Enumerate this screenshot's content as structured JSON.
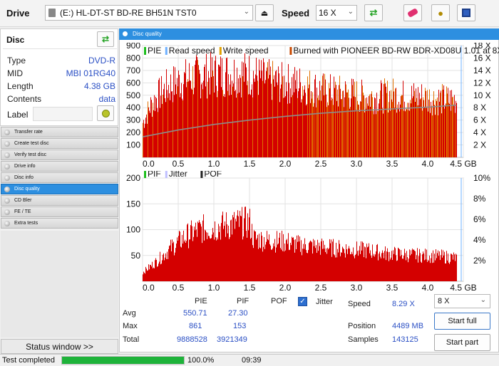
{
  "toolbar": {
    "drive_label": "Drive",
    "drive_value": "(E:)   HL-DT-ST BD-RE  BH51N TST0",
    "speed_label": "Speed",
    "speed_value": "16 X"
  },
  "disc": {
    "title": "Disc",
    "rows": [
      {
        "key": "Type",
        "value": "DVD-R"
      },
      {
        "key": "MID",
        "value": "MBI 01RG40"
      },
      {
        "key": "Length",
        "value": "4.38 GB"
      },
      {
        "key": "Contents",
        "value": "data"
      }
    ],
    "label_key": "Label",
    "label_value": ""
  },
  "nav": {
    "items": [
      "Transfer rate",
      "Create test disc",
      "Verify test disc",
      "Drive info",
      "Disc info",
      "Disc quality",
      "CD Bler",
      "FE / TE",
      "Extra tests"
    ],
    "active_index": 5
  },
  "main": {
    "title": "Disc quality"
  },
  "chart_data": [
    {
      "type": "area",
      "legend": [
        "PIE",
        "Read speed",
        "Write speed",
        "Burned with PIONEER BD-RW  BDR-XD08U 1.01 at 8X"
      ],
      "legend_colors": [
        "#1fbf1f",
        "#6fb0ff",
        "#e0a000",
        "#c84800"
      ],
      "y_ticks": [
        100,
        200,
        300,
        400,
        500,
        600,
        700,
        800,
        900
      ],
      "y_right_ticks": [
        "2 X",
        "4 X",
        "6 X",
        "8 X",
        "10 X",
        "12 X",
        "14 X",
        "16 X",
        "18 X"
      ],
      "x_ticks": [
        "0.0",
        "0.5",
        "1.0",
        "1.5",
        "2.0",
        "2.5",
        "3.0",
        "3.5",
        "4.0",
        "4.5 GB"
      ],
      "xlim": [
        0,
        4.5
      ],
      "ylim": [
        0,
        900
      ],
      "y2lim": [
        0,
        18
      ],
      "pie_profile": [
        [
          0.0,
          320
        ],
        [
          0.1,
          470
        ],
        [
          0.2,
          560
        ],
        [
          0.35,
          650
        ],
        [
          0.5,
          700
        ],
        [
          0.7,
          740
        ],
        [
          0.9,
          760
        ],
        [
          1.1,
          770
        ],
        [
          1.3,
          775
        ],
        [
          1.5,
          770
        ],
        [
          1.7,
          720
        ],
        [
          1.9,
          690
        ],
        [
          2.1,
          680
        ],
        [
          2.3,
          660
        ],
        [
          2.5,
          620
        ],
        [
          2.7,
          600
        ],
        [
          2.9,
          590
        ],
        [
          3.1,
          560
        ],
        [
          3.3,
          560
        ],
        [
          3.5,
          580
        ],
        [
          3.7,
          560
        ],
        [
          3.9,
          560
        ],
        [
          4.1,
          540
        ],
        [
          4.3,
          530
        ],
        [
          4.4,
          540
        ]
      ],
      "read_speed": [
        [
          0.0,
          3.3
        ],
        [
          0.5,
          4.4
        ],
        [
          1.0,
          5.3
        ],
        [
          1.5,
          6.0
        ],
        [
          2.0,
          6.6
        ],
        [
          2.5,
          7.1
        ],
        [
          3.0,
          7.5
        ],
        [
          3.5,
          7.8
        ],
        [
          4.0,
          8.1
        ],
        [
          4.4,
          8.4
        ]
      ]
    },
    {
      "type": "area",
      "legend": [
        "PIF",
        "Jitter",
        "POF"
      ],
      "legend_colors": [
        "#1fbf1f",
        "#c0c0ff",
        "#222222"
      ],
      "y_ticks": [
        50,
        100,
        150,
        200
      ],
      "y_right_ticks": [
        "2%",
        "4%",
        "6%",
        "8%",
        "10%"
      ],
      "x_ticks": [
        "0.0",
        "0.5",
        "1.0",
        "1.5",
        "2.0",
        "2.5",
        "3.0",
        "3.5",
        "4.0",
        "4.5 GB"
      ],
      "xlim": [
        0,
        4.5
      ],
      "ylim": [
        0,
        200
      ],
      "pif_profile": [
        [
          0.0,
          20
        ],
        [
          0.2,
          45
        ],
        [
          0.4,
          75
        ],
        [
          0.6,
          100
        ],
        [
          0.8,
          115
        ],
        [
          1.0,
          120
        ],
        [
          1.2,
          125
        ],
        [
          1.4,
          130
        ],
        [
          1.5,
          130
        ],
        [
          1.55,
          95
        ],
        [
          1.8,
          90
        ],
        [
          2.0,
          88
        ],
        [
          2.2,
          80
        ],
        [
          2.4,
          78
        ],
        [
          2.6,
          75
        ],
        [
          2.8,
          72
        ],
        [
          3.0,
          70
        ],
        [
          3.2,
          68
        ],
        [
          3.4,
          62
        ],
        [
          3.6,
          60
        ],
        [
          3.8,
          58
        ],
        [
          4.0,
          57
        ],
        [
          4.2,
          55
        ],
        [
          4.4,
          52
        ]
      ]
    }
  ],
  "stats": {
    "col_pie": "PIE",
    "col_pif": "PIF",
    "col_pof": "POF",
    "jitter_label": "Jitter",
    "avg_label": "Avg",
    "max_label": "Max",
    "total_label": "Total",
    "pie_avg": "550.71",
    "pif_avg": "27.30",
    "pie_max": "861",
    "pif_max": "153",
    "pie_total": "9888528",
    "pif_total": "3921349",
    "speed_label": "Speed",
    "speed_value": "8.29 X",
    "position_label": "Position",
    "position_value": "4489 MB",
    "samples_label": "Samples",
    "samples_value": "143125",
    "speed_select": "8 X",
    "start_full": "Start full",
    "start_part": "Start part"
  },
  "status": {
    "window_button": "Status window >>",
    "text": "Test completed",
    "progress": 1.0,
    "progress_text": "100.0%",
    "time": "09:39"
  },
  "colors": {
    "accent": "#2d8fe0",
    "bar_red": "#d40000",
    "progress_green": "#1eb33a",
    "value_blue": "#2a4fc4"
  }
}
